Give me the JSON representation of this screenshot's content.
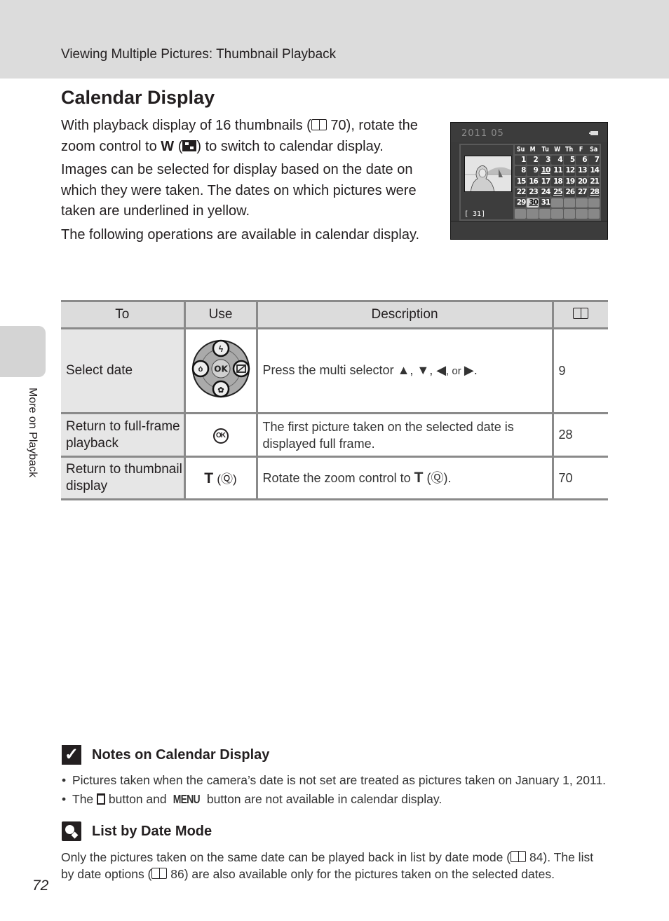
{
  "header": {
    "title": "Viewing Multiple Pictures: Thumbnail Playback"
  },
  "page_title": "Calendar Display",
  "intro": {
    "p1_a": "With playback display of 16 thumbnails (",
    "p1_ref": "70",
    "p1_b": "), rotate the zoom control to ",
    "p1_w": "W",
    "p1_c": " (",
    "p1_d": ") to switch to calendar display.",
    "p2": "Images can be selected for display based on the date on which they were taken. The dates on which pictures were taken are underlined in yellow.",
    "p3": "The following operations are available in calendar display."
  },
  "camera_screen": {
    "date": "2011  05",
    "image_count": "[      31]",
    "weekdays": [
      "Su",
      "M",
      "Tu",
      "W",
      "Th",
      "F",
      "Sa"
    ],
    "days": [
      {
        "d": "1"
      },
      {
        "d": "2"
      },
      {
        "d": "3"
      },
      {
        "d": "4"
      },
      {
        "d": "5"
      },
      {
        "d": "6"
      },
      {
        "d": "7"
      },
      {
        "d": "8"
      },
      {
        "d": "9"
      },
      {
        "d": "10",
        "marked": true
      },
      {
        "d": "11"
      },
      {
        "d": "12"
      },
      {
        "d": "13"
      },
      {
        "d": "14"
      },
      {
        "d": "15"
      },
      {
        "d": "16"
      },
      {
        "d": "17"
      },
      {
        "d": "18"
      },
      {
        "d": "19"
      },
      {
        "d": "20"
      },
      {
        "d": "21"
      },
      {
        "d": "22"
      },
      {
        "d": "23"
      },
      {
        "d": "24"
      },
      {
        "d": "25",
        "marked": true
      },
      {
        "d": "26"
      },
      {
        "d": "27"
      },
      {
        "d": "28",
        "marked": true
      },
      {
        "d": "29"
      },
      {
        "d": "30",
        "selected": true,
        "marked": true
      },
      {
        "d": "31"
      },
      {
        "d": ""
      },
      {
        "d": ""
      },
      {
        "d": ""
      },
      {
        "d": ""
      },
      {
        "d": ""
      },
      {
        "d": ""
      },
      {
        "d": ""
      },
      {
        "d": ""
      },
      {
        "d": ""
      },
      {
        "d": ""
      },
      {
        "d": ""
      }
    ]
  },
  "table": {
    "headers": {
      "to": "To",
      "use": "Use",
      "description": "Description",
      "ref_icon": "book-icon"
    },
    "rows": [
      {
        "to": "Select date",
        "use_icon": "multi-selector-icon",
        "description_a": "Press the multi selector ▲, ▼, ◀",
        "description_or": ", or ",
        "description_b": "▶.",
        "ref": "9"
      },
      {
        "to": "Return to full-frame playback",
        "use_icon": "ok-button-icon",
        "use_text": "OK",
        "description": "The first picture taken on the selected date is displayed full frame.",
        "ref": "28"
      },
      {
        "to": "Return to thumbnail display",
        "use_t": "T",
        "use_mag": "(Ⓠ)",
        "description_a": "Rotate the zoom control to ",
        "description_t": "T",
        "description_b": " (Ⓠ).",
        "ref": "70"
      }
    ]
  },
  "sidebar": {
    "label": "More on Playback"
  },
  "notes": {
    "title": "Notes on Calendar Display",
    "items": [
      "Pictures taken when the camera’s date is not set are treated as pictures taken on January 1, 2011."
    ],
    "item2_a": "The ",
    "item2_b": " button and ",
    "item2_menu": "MENU",
    "item2_c": " button are not available in calendar display."
  },
  "tip": {
    "title": "List by Date Mode",
    "body_a": "Only the pictures taken on the same date can be played back in list by date mode (",
    "ref1": "84",
    "body_b": "). The list by date options (",
    "ref2": "86",
    "body_c": ") are also available only for the pictures taken on the selected dates."
  },
  "page_number": "72"
}
